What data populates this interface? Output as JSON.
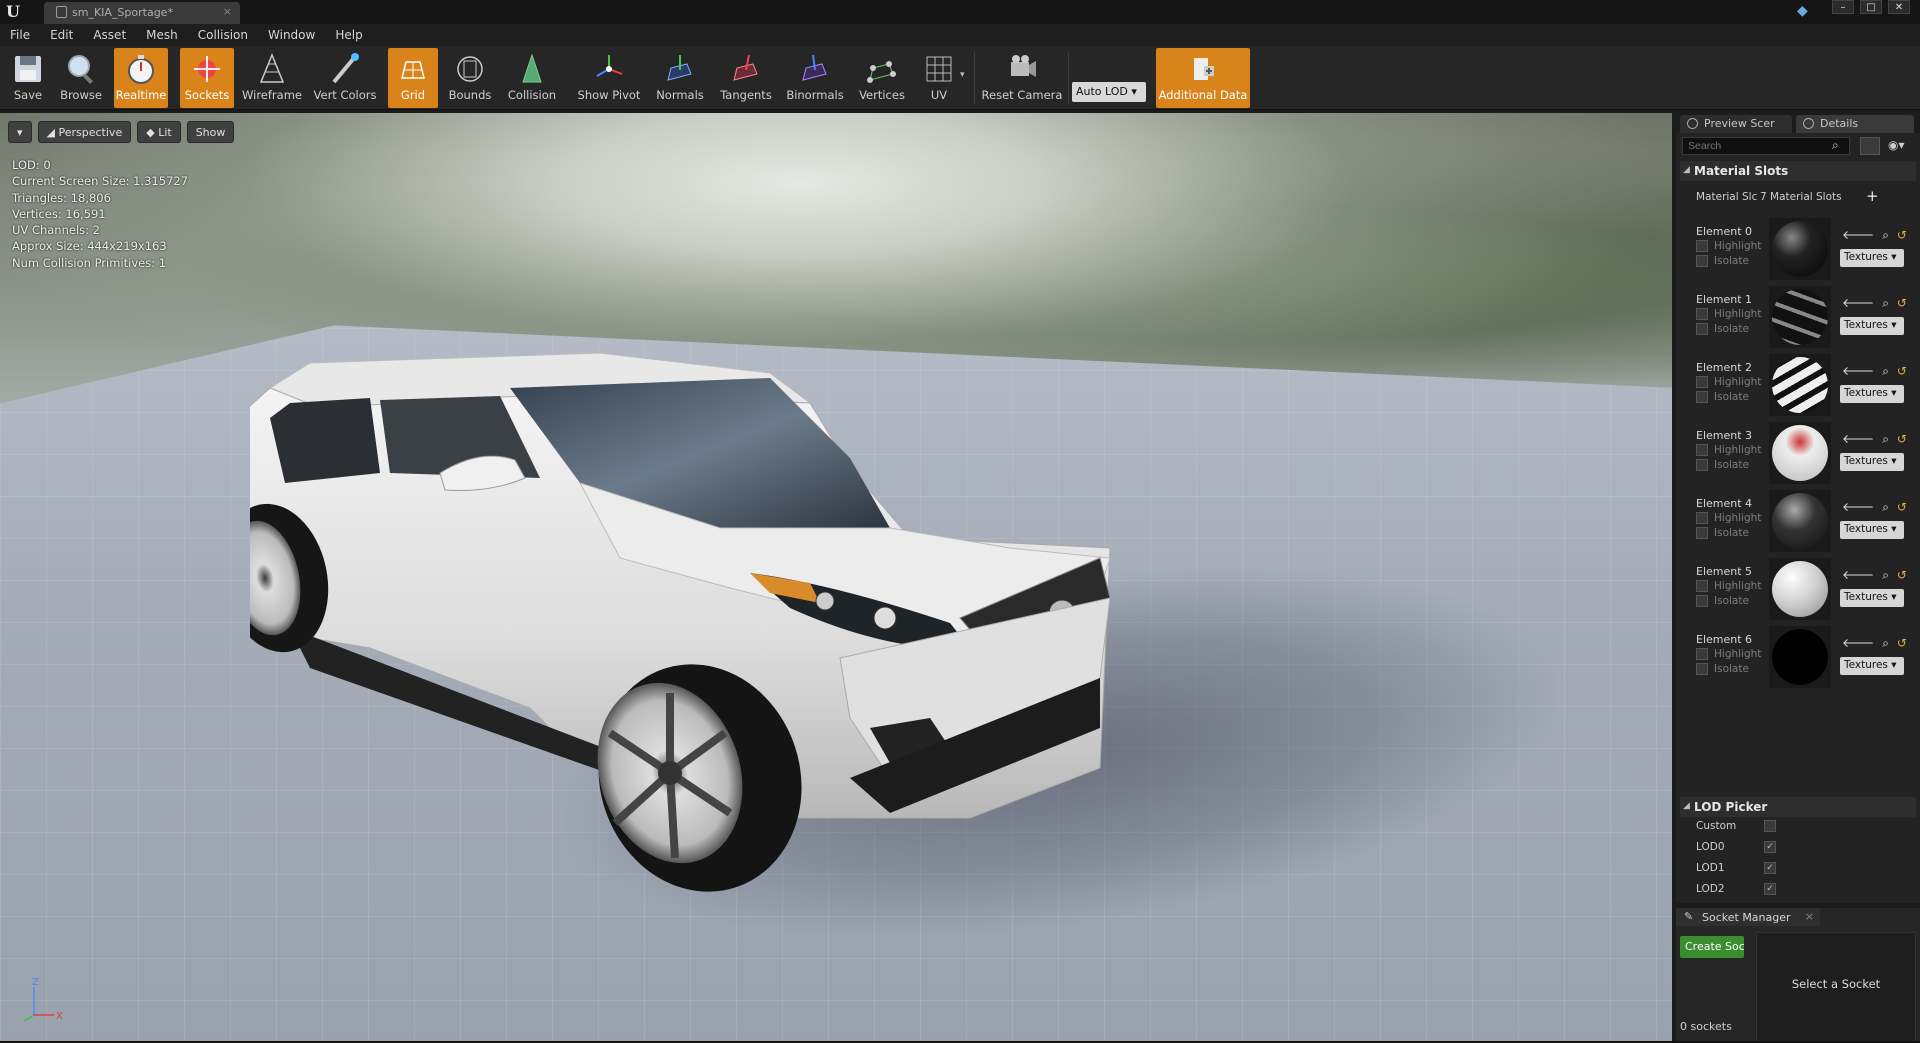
{
  "titlebar": {
    "tab_title": "sm_KIA_Sportage*",
    "logo": "U"
  },
  "menu": [
    "File",
    "Edit",
    "Asset",
    "Mesh",
    "Collision",
    "Window",
    "Help"
  ],
  "toolbar": {
    "buttons": [
      {
        "label": "Save",
        "icon": "save-icon",
        "active": false
      },
      {
        "label": "Browse",
        "icon": "browse-icon",
        "active": false
      },
      {
        "label": "Realtime",
        "icon": "realtime-icon",
        "active": true
      },
      {
        "label": "Sockets",
        "icon": "sockets-icon",
        "active": true
      },
      {
        "label": "Wireframe",
        "icon": "wireframe-icon",
        "active": false
      },
      {
        "label": "Vert Colors",
        "icon": "vert-colors-icon",
        "active": false
      },
      {
        "label": "Grid",
        "icon": "grid-icon",
        "active": true
      },
      {
        "label": "Bounds",
        "icon": "bounds-icon",
        "active": false
      },
      {
        "label": "Collision",
        "icon": "collision-icon",
        "active": false
      },
      {
        "label": "Show Pivot",
        "icon": "pivot-icon",
        "active": false
      },
      {
        "label": "Normals",
        "icon": "normals-icon",
        "active": false
      },
      {
        "label": "Tangents",
        "icon": "tangents-icon",
        "active": false
      },
      {
        "label": "Binormals",
        "icon": "binormals-icon",
        "active": false
      },
      {
        "label": "Vertices",
        "icon": "vertices-icon",
        "active": false
      },
      {
        "label": "UV",
        "icon": "uv-icon",
        "active": false
      },
      {
        "label": "Reset Camera",
        "icon": "reset-camera-icon",
        "active": false
      },
      {
        "label": "Additional Data",
        "icon": "additional-data-icon",
        "active": true
      }
    ],
    "lod_select": "Auto LOD"
  },
  "viewport": {
    "buttons": {
      "menu": "▾",
      "perspective": "Perspective",
      "lit": "Lit",
      "show": "Show"
    },
    "stats": [
      "LOD:  0",
      "Current Screen Size:  1.315727",
      "Triangles:  18,806",
      "Vertices:  16,591",
      "UV Channels:  2",
      "Approx Size: 444x219x163",
      "Num Collision Primitives:  1"
    ],
    "axis": {
      "x": "X",
      "z": "Z"
    }
  },
  "panel": {
    "tabs": [
      "Preview Scer",
      "Details"
    ],
    "search_placeholder": "Search",
    "material_slots": {
      "title": "Material Slots",
      "label": "Material Slc",
      "count": "7 Material Slots",
      "add": "+",
      "highlight": "Highlight",
      "isolate": "Isolate",
      "dropdown": "Textures",
      "elements": [
        "Element 0",
        "Element 1",
        "Element 2",
        "Element 3",
        "Element 4",
        "Element 5",
        "Element 6"
      ]
    },
    "lod_picker": {
      "title": "LOD Picker",
      "items": [
        {
          "label": "Custom",
          "checked": false
        },
        {
          "label": "LOD0",
          "checked": true
        },
        {
          "label": "LOD1",
          "checked": true
        },
        {
          "label": "LOD2",
          "checked": true
        }
      ]
    }
  },
  "socket_manager": {
    "title": "Socket Manager",
    "create": "Create Soc",
    "count": "0 sockets",
    "select": "Select a Socket"
  }
}
